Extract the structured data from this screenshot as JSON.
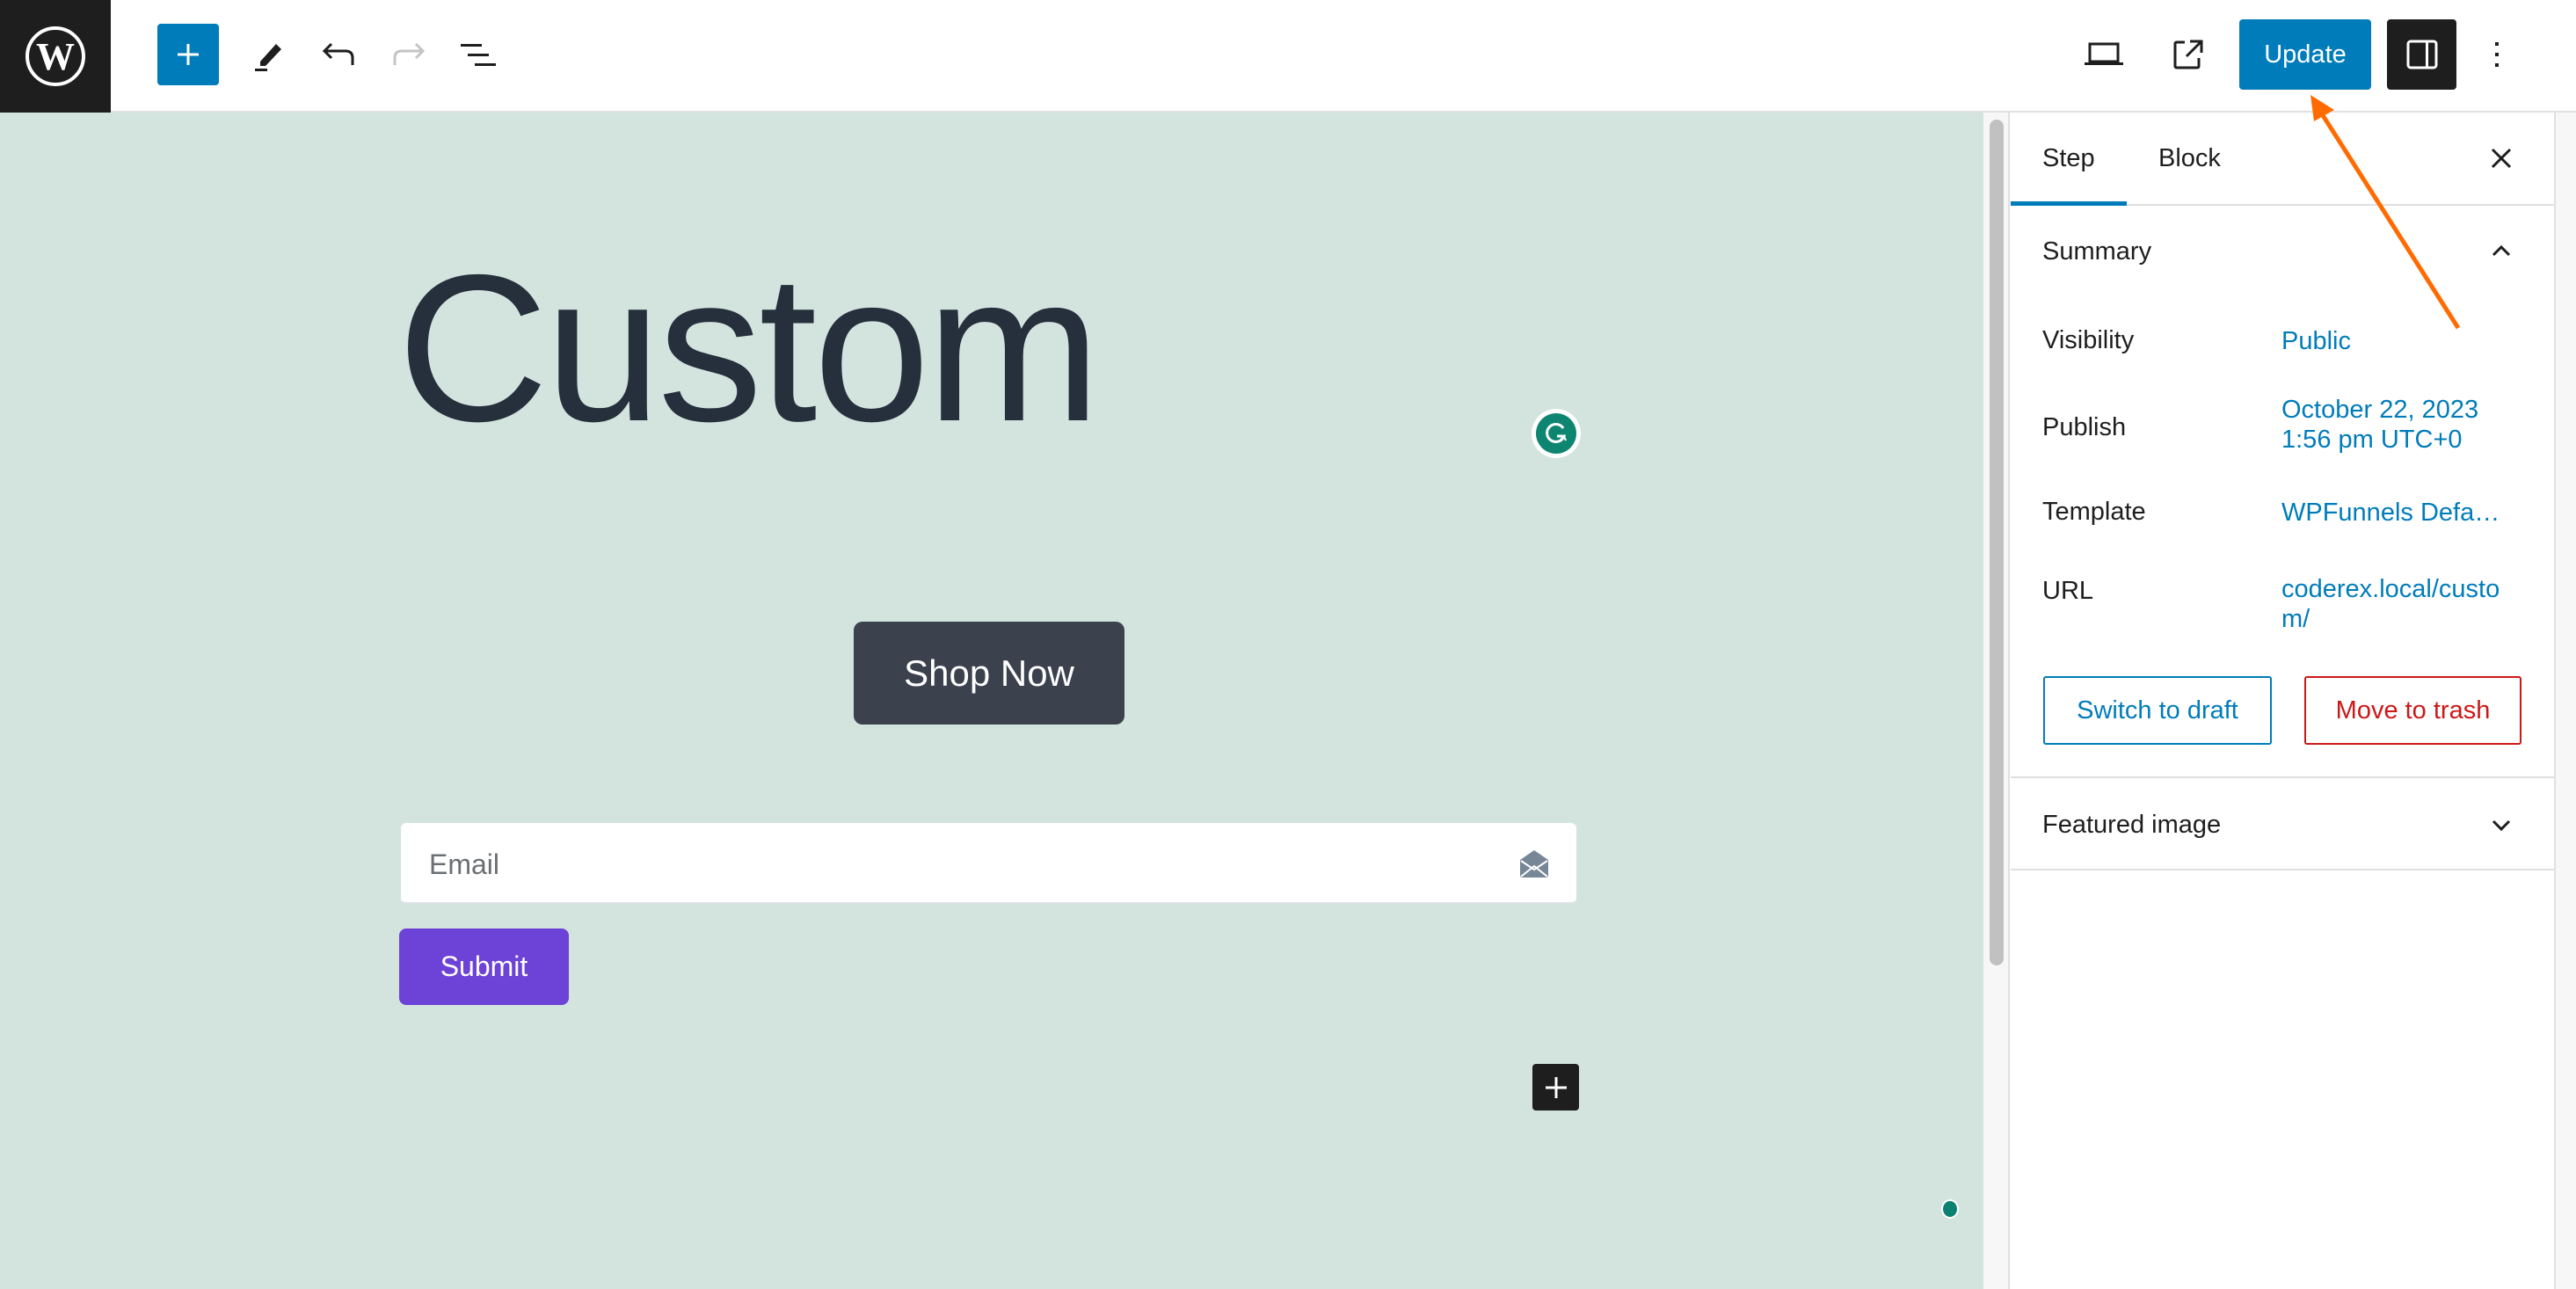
{
  "header": {
    "logo": "wordpress-logo",
    "tools": [
      {
        "name": "add-block",
        "icon": "plus-icon"
      },
      {
        "name": "tools",
        "icon": "pencil-icon"
      },
      {
        "name": "undo",
        "icon": "undo-icon"
      },
      {
        "name": "redo",
        "icon": "redo-icon",
        "disabled": true
      },
      {
        "name": "document-overview",
        "icon": "list-view-icon"
      }
    ],
    "right_tools": [
      {
        "name": "preview",
        "icon": "laptop-icon"
      },
      {
        "name": "view-page",
        "icon": "external-link-icon"
      }
    ],
    "update_label": "Update",
    "settings_icon": "sidebar-toggle-icon",
    "options_icon": "more-vertical-icon"
  },
  "canvas": {
    "heading": "Custom",
    "shop_button_label": "Shop Now",
    "email_placeholder": "Email",
    "email_value": "",
    "submit_label": "Submit",
    "grammarly_icon": "grammarly-icon",
    "background_color": "#d3e4de"
  },
  "sidebar": {
    "tabs": [
      {
        "label": "Step",
        "active": true
      },
      {
        "label": "Block",
        "active": false
      }
    ],
    "summary": {
      "title": "Summary",
      "expanded": true,
      "rows": [
        {
          "label": "Visibility",
          "value": "Public"
        },
        {
          "label": "Publish",
          "value": "October 22, 2023 1:56 pm UTC+0"
        },
        {
          "label": "Template",
          "value": "WPFunnels Defa…"
        },
        {
          "label": "URL",
          "value": "coderex.local/custom/"
        }
      ],
      "switch_draft_label": "Switch to draft",
      "trash_label": "Move to trash"
    },
    "featured_image": {
      "title": "Featured image",
      "expanded": false
    }
  },
  "colors": {
    "accent": "#007cba",
    "danger": "#cc1818",
    "submit": "#6d42d6",
    "shop_button": "#3b414d",
    "annotation_arrow": "#ff6b00"
  }
}
